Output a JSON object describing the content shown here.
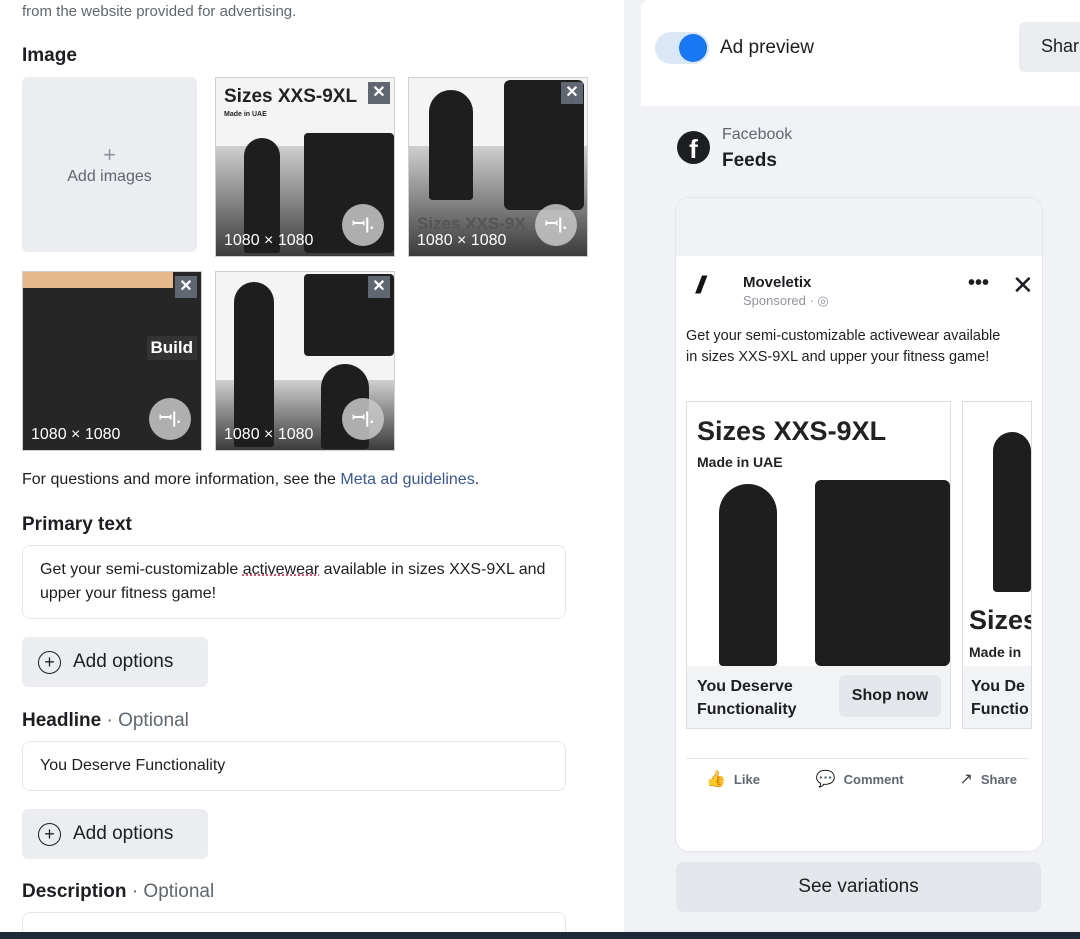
{
  "intro": "from the website provided for advertising.",
  "image_section": {
    "title": "Image",
    "add_label": "Add images",
    "add_plus": "+",
    "thumb_close": "✕",
    "thumb_crop": "ꟷ|.",
    "thumbs": [
      {
        "dim": "1080 × 1080",
        "title": "Sizes XXS-9XL",
        "sub": "Made in UAE"
      },
      {
        "dim": "1080 × 1080",
        "title": "Sizes XXS-9X"
      },
      {
        "dim": "1080 × 1080",
        "badge": "Build"
      },
      {
        "dim": "1080 × 1080"
      }
    ]
  },
  "guidelines": {
    "prefix": "For questions and more information, see the ",
    "link": "Meta ad guidelines",
    "suffix": "."
  },
  "primary_text": {
    "title": "Primary text",
    "before": "Get your semi-customizable ",
    "marked": "activewear",
    "after": " available in sizes XXS-9XL and upper your fitness game!"
  },
  "add_options_label": "Add options",
  "add_options_icon": "+",
  "headline": {
    "title": "Headline",
    "optional": "· Optional",
    "value": "You Deserve Functionality"
  },
  "description": {
    "title": "Description",
    "optional": "· Optional"
  },
  "preview": {
    "label": "Ad preview",
    "share_label": "Shar",
    "toggle_on": true,
    "platform": "Facebook",
    "placement": "Feeds",
    "fb_glyph": "f"
  },
  "post": {
    "brand_mark": "//",
    "brand": "Moveletix",
    "sponsored": "Sponsored · ◎",
    "more": "•••",
    "close": "✕",
    "text": "Get your semi-customizable activewear available in sizes XXS-9XL and upper your fitness game!",
    "cards": [
      {
        "title": "Sizes XXS-9XL",
        "made": "Made in UAE",
        "caption_1": "You Deserve",
        "caption_2": "Functionality",
        "cta": "Shop now"
      },
      {
        "title": "Sizes",
        "made": "Made in",
        "caption_1": "You De",
        "caption_2": "Functio"
      }
    ],
    "actions": {
      "like": "Like",
      "comment": "Comment",
      "share": "Share"
    },
    "action_icons": {
      "like": "👍",
      "comment": "💬",
      "share": "↗"
    }
  },
  "see_variations": "See variations",
  "colors": {
    "accent": "#1877f2",
    "link": "#385898",
    "toggle_track": "#dbe7f7"
  }
}
